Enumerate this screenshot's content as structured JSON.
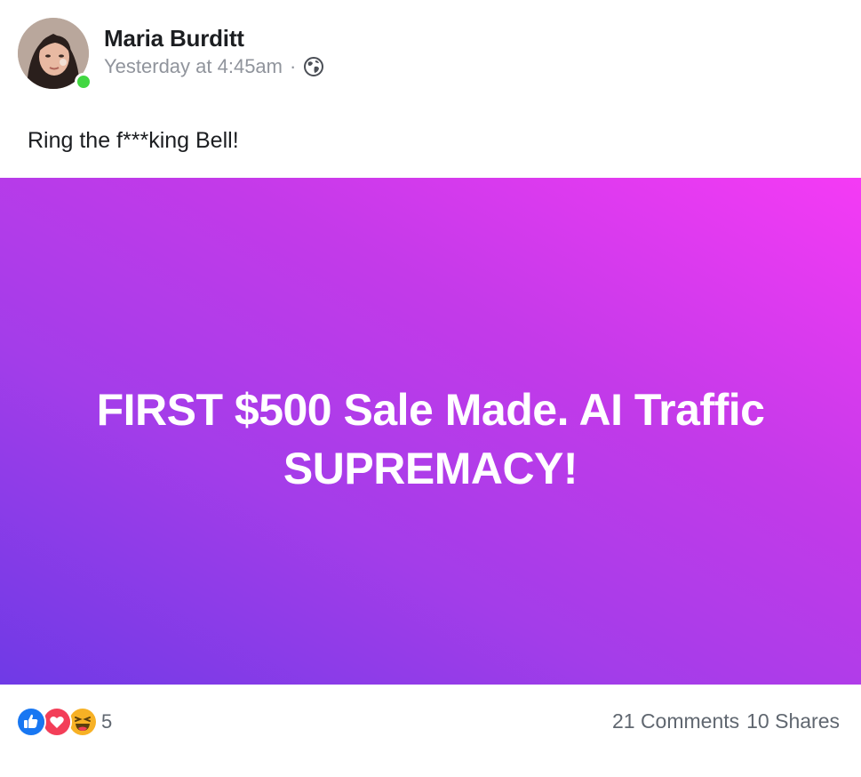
{
  "post": {
    "author": "Maria Burditt",
    "timestamp": "Yesterday at 4:45am",
    "separator": "·",
    "privacy_icon": "globe-icon",
    "text": "Ring the f***king Bell!",
    "image": {
      "line1": "FIRST $500 Sale Made. AI Traffic",
      "line2": "SUPREMACY!",
      "gradient_colors": [
        "#6f3ae6",
        "#a33de9",
        "#f53af5"
      ]
    }
  },
  "footer": {
    "reaction_icons": [
      "like-icon",
      "love-icon",
      "haha-icon"
    ],
    "reaction_count": "5",
    "comments": "21 Comments",
    "shares": "10 Shares"
  },
  "colors": {
    "online": "#42d742",
    "meta_text": "#90949c",
    "like": "#1877f2",
    "love": "#f33e58",
    "haha": "#f7b125"
  }
}
